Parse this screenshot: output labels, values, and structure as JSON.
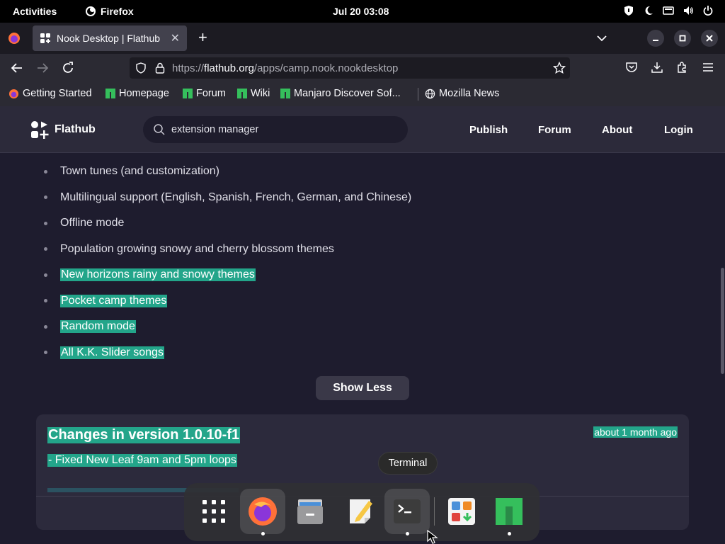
{
  "topbar": {
    "activities": "Activities",
    "app_name": "Firefox",
    "clock": "Jul 20  03:08"
  },
  "browser": {
    "tab_title": "Nook Desktop | Flathub",
    "url_prefix": "https://",
    "url_domain": "flathub.org",
    "url_path": "/apps/camp.nook.nookdesktop",
    "bookmarks": [
      "Getting Started",
      "Homepage",
      "Forum",
      "Wiki",
      "Manjaro Discover Sof...",
      "Mozilla News"
    ]
  },
  "flathub": {
    "logo_text": "Flathub",
    "search_value": "extension manager",
    "nav": [
      "Publish",
      "Forum",
      "About",
      "Login"
    ]
  },
  "features": [
    {
      "text": "Town tunes (and customization)",
      "selected": false
    },
    {
      "text": "Multilingual support (English, Spanish, French, German, and Chinese)",
      "selected": false
    },
    {
      "text": "Offline mode",
      "selected": false
    },
    {
      "text": "Population growing snowy and cherry blossom themes",
      "selected": false
    },
    {
      "text": "New horizons rainy and snowy themes",
      "selected": true
    },
    {
      "text": "Pocket camp themes",
      "selected": true
    },
    {
      "text": "Random mode",
      "selected": true
    },
    {
      "text": "All K.K. Slider songs",
      "selected": true
    }
  ],
  "show_less_label": "Show Less",
  "release": {
    "title": "Changes in version 1.0.10-f1",
    "date": "about 1 month ago",
    "note": "- Fixed New Leaf 9am and 5pm loops"
  },
  "dock": {
    "tooltip": "Terminal",
    "items": [
      "App Grid",
      "Firefox",
      "Files",
      "Text Editor",
      "Terminal",
      "Software",
      "Manjaro Hello"
    ]
  },
  "colors": {
    "selection": "#23a58a",
    "flathub_bg": "#1e1c2e",
    "header_bg": "#2c2a3a"
  }
}
